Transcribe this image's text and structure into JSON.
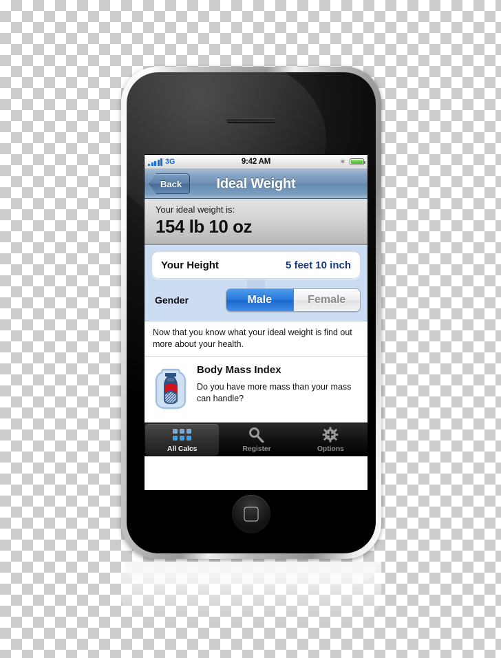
{
  "device": {
    "name": "iphone-3gs",
    "earpiece": "earpiece-speaker",
    "home_button": "home-button"
  },
  "status_bar": {
    "carrier": "3G",
    "signal_icon": "signal-bars-icon",
    "time": "9:42 AM",
    "bluetooth_icon": "✶",
    "battery_icon": "battery-full-icon"
  },
  "nav_bar": {
    "back_label": "Back",
    "title": "Ideal Weight"
  },
  "result": {
    "label": "Your ideal weight is:",
    "value": "154 lb 10 oz"
  },
  "form": {
    "height": {
      "label": "Your Height",
      "value": "5 feet 10 inch"
    },
    "gender": {
      "label": "Gender",
      "options": [
        "Male",
        "Female"
      ],
      "selected": "Male"
    }
  },
  "info": {
    "text": "Now that you know what your ideal weight is find out more about your health."
  },
  "bmi": {
    "icon": "weight-kettlebell-icon",
    "title": "Body Mass Index",
    "description": "Do you have more mass than your mass can handle?"
  },
  "tabs": [
    {
      "label": "All Calcs",
      "icon": "grid-icon",
      "selected": true
    },
    {
      "label": "Register",
      "icon": "key-plus-icon",
      "selected": false
    },
    {
      "label": "Options",
      "icon": "gear-plus-icon",
      "selected": false
    }
  ],
  "colors": {
    "accent_blue": "#2579dd",
    "link_blue": "#15387d",
    "form_background": "#ccdcf2",
    "battery_green": "#3fb82a",
    "bmi_red": "#d4101a"
  }
}
